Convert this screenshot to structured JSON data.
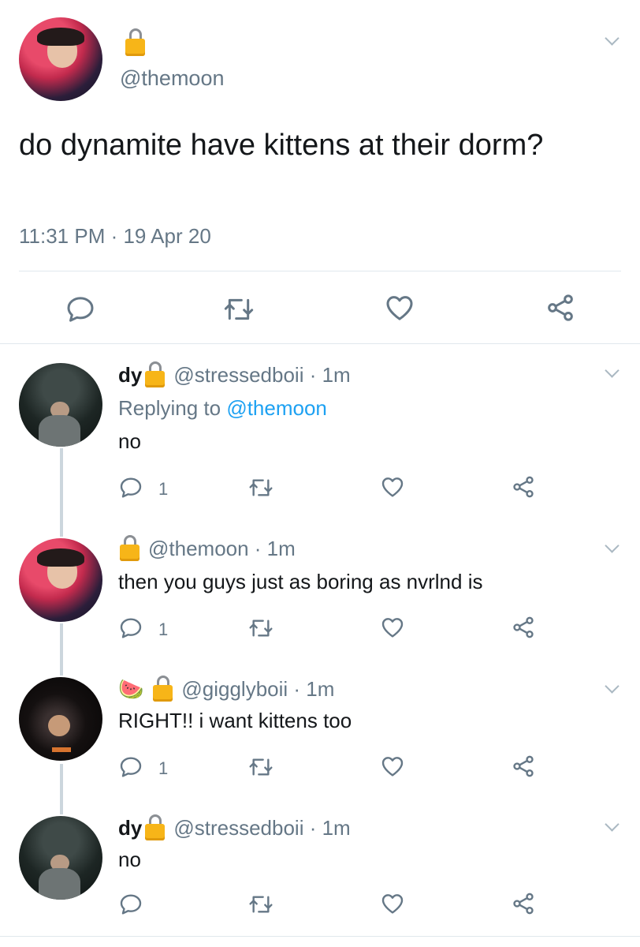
{
  "main_tweet": {
    "handle": "@themoon",
    "text": "do dynamite have kittens at their dorm?",
    "time": "11:31 PM · 19 Apr 20"
  },
  "replies": [
    {
      "name": "dy",
      "handle": "@stressedboii · 1m",
      "replying_label": "Replying to ",
      "replying_to": "@themoon",
      "text": "no",
      "reply_count": "1"
    },
    {
      "name": "",
      "handle": "@themoon · 1m",
      "text": "then you guys just as boring as nvrlnd is",
      "reply_count": "1"
    },
    {
      "name": "🍉",
      "handle": "@gigglyboii · 1m",
      "text": "RIGHT!! i want kittens too",
      "reply_count": "1"
    },
    {
      "name": "dy",
      "handle": "@stressedboii · 1m",
      "text": "no",
      "reply_count": ""
    }
  ],
  "icons": [
    "lock-icon",
    "chevron-down-icon",
    "reply-icon",
    "retweet-icon",
    "like-icon",
    "share-icon"
  ],
  "colors": {
    "text": "#14171a",
    "secondary": "#657786",
    "link": "#1da1f2",
    "lock": "#f7b518",
    "divider": "#e1e8ed",
    "thread_line": "#ccd6dd"
  }
}
